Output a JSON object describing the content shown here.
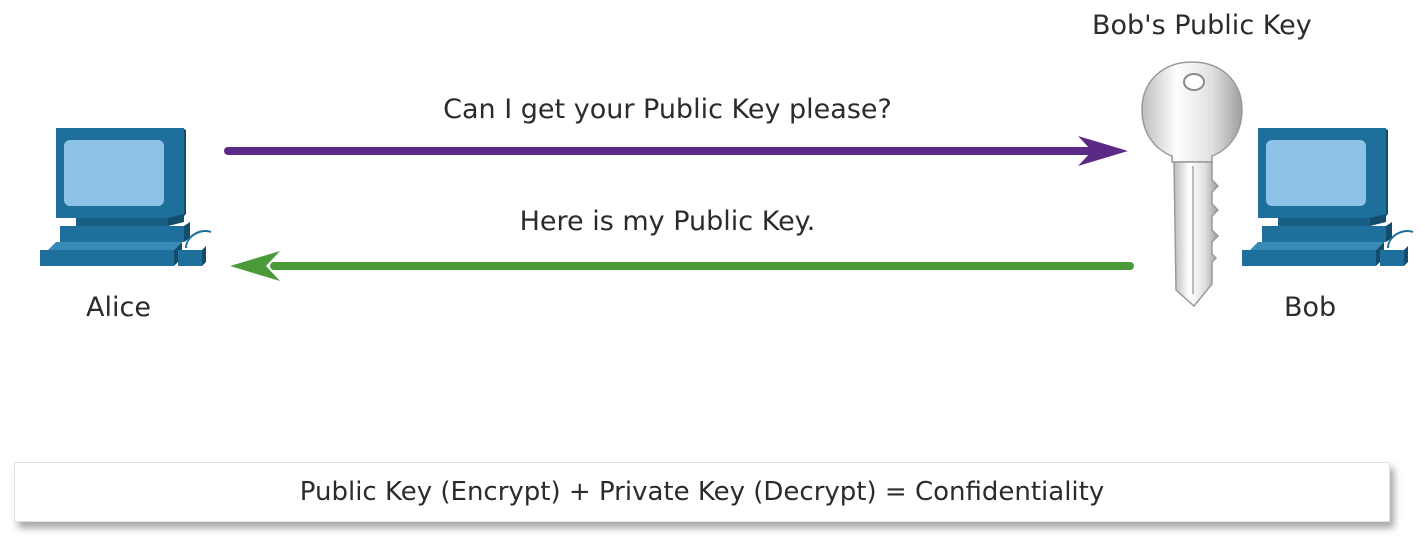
{
  "participants": {
    "left": {
      "name": "Alice"
    },
    "right": {
      "name": "Bob"
    }
  },
  "key": {
    "label": "Bob's Public Key",
    "icon": "key-icon"
  },
  "messages": [
    {
      "text": "Can I get your Public Key please?",
      "direction": "left-to-right",
      "color": "#5b2a86"
    },
    {
      "text": "Here is my Public Key.",
      "direction": "right-to-left",
      "color": "#4a9a3a"
    }
  ],
  "formula": {
    "text": "Public Key (Encrypt) + Private Key (Decrypt) = Confidentiality"
  },
  "colors": {
    "computer_body": "#1f6f9c",
    "computer_screen": "#8cc3e6",
    "request_arrow": "#5b2a86",
    "response_arrow": "#4a9a3a"
  }
}
